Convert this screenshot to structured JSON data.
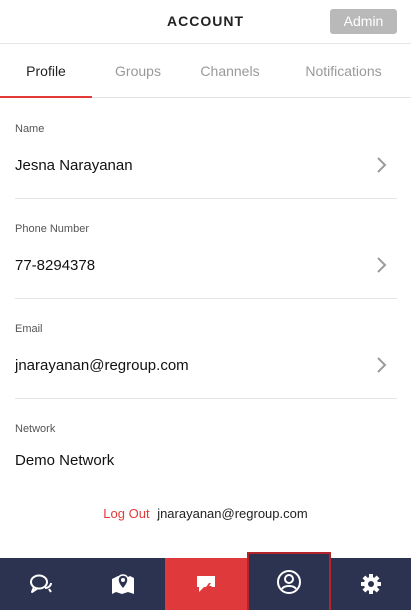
{
  "header": {
    "title": "ACCOUNT",
    "admin_label": "Admin"
  },
  "tabs": [
    {
      "label": "Profile",
      "active": true
    },
    {
      "label": "Groups",
      "active": false
    },
    {
      "label": "Channels",
      "active": false
    },
    {
      "label": "Notifications",
      "active": false
    }
  ],
  "fields": [
    {
      "label": "Name",
      "value": "Jesna Narayanan"
    },
    {
      "label": "Phone Number",
      "value": "77-8294378"
    },
    {
      "label": "Email",
      "value": "jnarayanan@regroup.com"
    },
    {
      "label": "Network",
      "value": "Demo Network"
    }
  ],
  "footer": {
    "logout_label": "Log Out",
    "logout_email": "jnarayanan@regroup.com"
  },
  "bottom_nav": {
    "items": [
      {
        "icon": "chat-bubbles-icon"
      },
      {
        "icon": "map-pin-icon"
      },
      {
        "icon": "messages-icon"
      },
      {
        "icon": "user-profile-icon"
      },
      {
        "icon": "gear-icon"
      }
    ]
  },
  "colors": {
    "accent": "#e23b37",
    "nav_background": "#2b3350",
    "admin_button": "#b9b9b9"
  }
}
